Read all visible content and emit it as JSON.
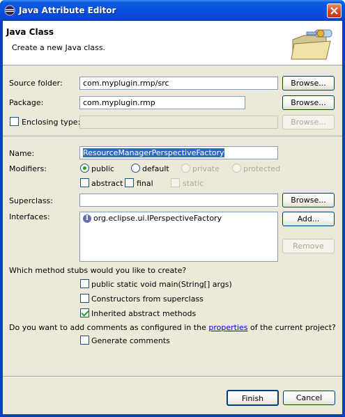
{
  "window": {
    "title": "Java Attribute Editor"
  },
  "banner": {
    "title": "Java Class",
    "description": "Create a new Java class."
  },
  "form": {
    "source_folder": {
      "label": "Source folder:",
      "value": "com.myplugin.rmp/src",
      "browse": "Browse..."
    },
    "package": {
      "label": "Package:",
      "value": "com.myplugin.rmp",
      "browse": "Browse..."
    },
    "enclosing_type": {
      "label": "Enclosing type:",
      "value": "",
      "browse": "Browse...",
      "checked": false
    },
    "name": {
      "label": "Name:",
      "value": "ResourceManagerPerspectiveFactory"
    },
    "modifiers": {
      "label": "Modifiers:",
      "public": "public",
      "default": "default",
      "private": "private",
      "protected": "protected",
      "abstract": "abstract",
      "final": "final",
      "static": "static",
      "selected": "public"
    },
    "superclass": {
      "label": "Superclass:",
      "value": "",
      "browse": "Browse..."
    },
    "interfaces": {
      "label": "Interfaces:",
      "items": [
        "org.eclipse.ui.IPerspectiveFactory"
      ],
      "add": "Add...",
      "remove": "Remove"
    },
    "stubs": {
      "question": "Which method stubs would you like to create?",
      "main": {
        "label": "public static void main(String[] args)",
        "checked": false
      },
      "constructors": {
        "label": "Constructors from superclass",
        "checked": false
      },
      "inherited": {
        "label": "Inherited abstract methods",
        "checked": true
      }
    },
    "comments": {
      "question_before": "Do you want to add comments as configured in the ",
      "link": "properties",
      "question_after": " of the current project?",
      "generate": {
        "label": "Generate comments",
        "checked": false
      }
    }
  },
  "buttons": {
    "finish": "Finish",
    "cancel": "Cancel"
  }
}
